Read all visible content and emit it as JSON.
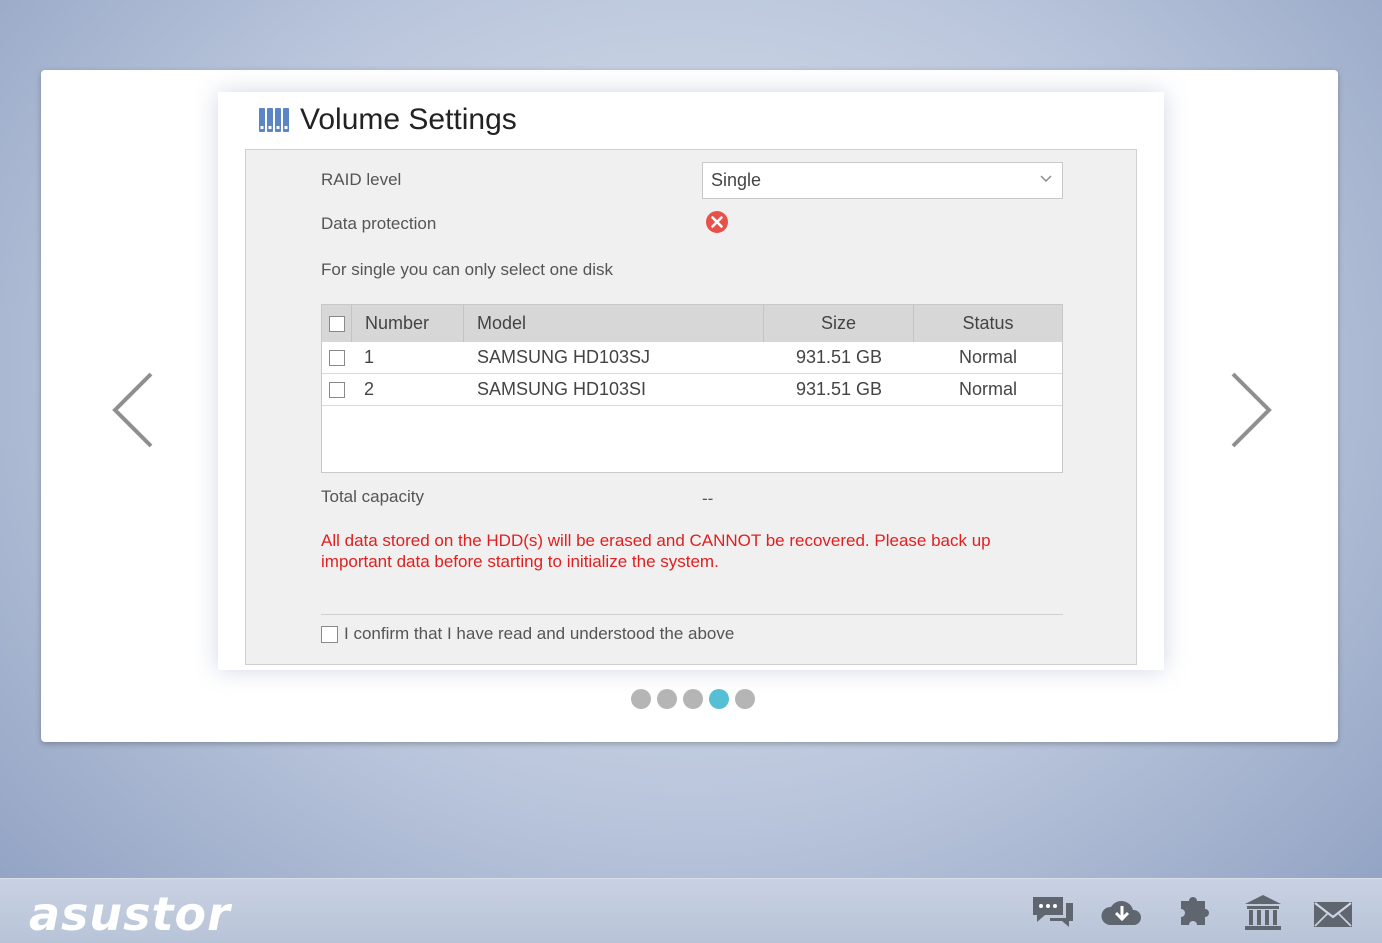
{
  "page": {
    "title": "Volume Settings",
    "title_icon": "volume-disks-icon"
  },
  "form": {
    "raid_label": "RAID level",
    "raid_value": "Single",
    "protection_label": "Data protection",
    "protection_status_icon": "error-x-icon",
    "hint": "For single you can only select one disk",
    "capacity_label": "Total capacity",
    "capacity_value": "--",
    "warning": "All data stored on the HDD(s) will be erased and CANNOT be recovered. Please back up important data before starting to initialize the system.",
    "confirm_label": "I confirm that I have read and understood the above"
  },
  "table": {
    "headers": [
      "Number",
      "Model",
      "Size",
      "Status"
    ],
    "rows": [
      {
        "number": "1",
        "model": "SAMSUNG HD103SJ",
        "size": "931.51 GB",
        "status": "Normal"
      },
      {
        "number": "2",
        "model": "SAMSUNG HD103SI",
        "size": "931.51 GB",
        "status": "Normal"
      }
    ]
  },
  "pager": {
    "total": 5,
    "active": 4
  },
  "footer": {
    "logo": "asustor",
    "icons": [
      "chat-icon",
      "cloud-download-icon",
      "plugin-icon",
      "bank-icon",
      "mail-icon"
    ]
  },
  "colors": {
    "warning": "#e02020",
    "active_dot": "#56bfd6",
    "error_icon": "#e8504a"
  }
}
